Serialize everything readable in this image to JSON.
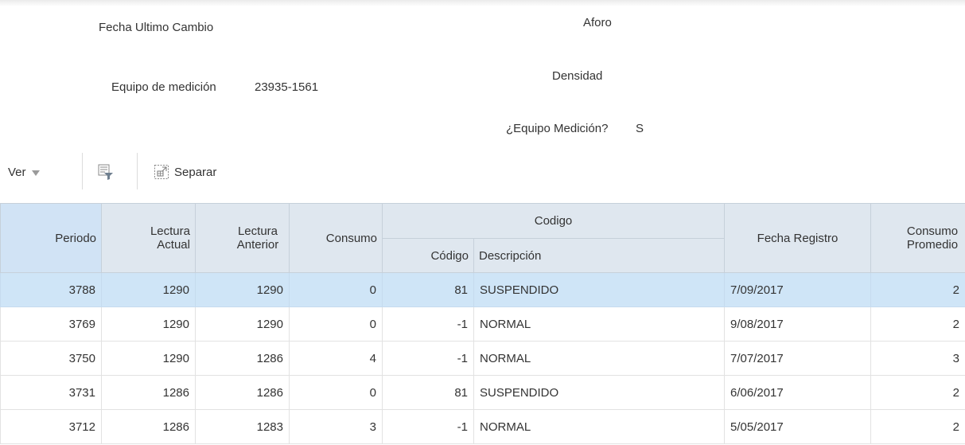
{
  "form": {
    "fecha_ultimo_cambio_label": "Fecha Ultimo Cambio",
    "aforo_label": "Aforo",
    "equipo_medicion_label": "Equipo de medición",
    "equipo_medicion_value": "23935-1561",
    "densidad_label": "Densidad",
    "equipo_medicion_flag_label": "¿Equipo Medición?",
    "equipo_medicion_flag_value": "S"
  },
  "toolbar": {
    "ver_label": "Ver",
    "separar_label": "Separar",
    "filter_icon": "query-filter-icon",
    "detach_icon": "detach-icon"
  },
  "table": {
    "headers": {
      "periodo": "Periodo",
      "lectura_actual": "Lectura Actual",
      "lectura_anterior": "Lectura Anterior",
      "consumo": "Consumo",
      "codigo_group": "Codigo",
      "codigo": "Código",
      "descripcion": "Descripción",
      "fecha_registro": "Fecha Registro",
      "consumo_promedio": "Consumo Promedio"
    },
    "rows": [
      {
        "periodo": "3788",
        "lectura_actual": "1290",
        "lectura_anterior": "1290",
        "consumo": "0",
        "codigo": "81",
        "descripcion": "SUSPENDIDO",
        "fecha_registro": "7/09/2017",
        "consumo_promedio": "2"
      },
      {
        "periodo": "3769",
        "lectura_actual": "1290",
        "lectura_anterior": "1290",
        "consumo": "0",
        "codigo": "-1",
        "descripcion": "NORMAL",
        "fecha_registro": "9/08/2017",
        "consumo_promedio": "2"
      },
      {
        "periodo": "3750",
        "lectura_actual": "1290",
        "lectura_anterior": "1286",
        "consumo": "4",
        "codigo": "-1",
        "descripcion": "NORMAL",
        "fecha_registro": "7/07/2017",
        "consumo_promedio": "3"
      },
      {
        "periodo": "3731",
        "lectura_actual": "1286",
        "lectura_anterior": "1286",
        "consumo": "0",
        "codigo": "81",
        "descripcion": "SUSPENDIDO",
        "fecha_registro": "6/06/2017",
        "consumo_promedio": "2"
      },
      {
        "periodo": "3712",
        "lectura_actual": "1286",
        "lectura_anterior": "1283",
        "consumo": "3",
        "codigo": "-1",
        "descripcion": "NORMAL",
        "fecha_registro": "5/05/2017",
        "consumo_promedio": "2"
      }
    ]
  },
  "colors": {
    "header_bg": "#dfe7ef",
    "selected_row_bg": "#cfe5f7"
  }
}
